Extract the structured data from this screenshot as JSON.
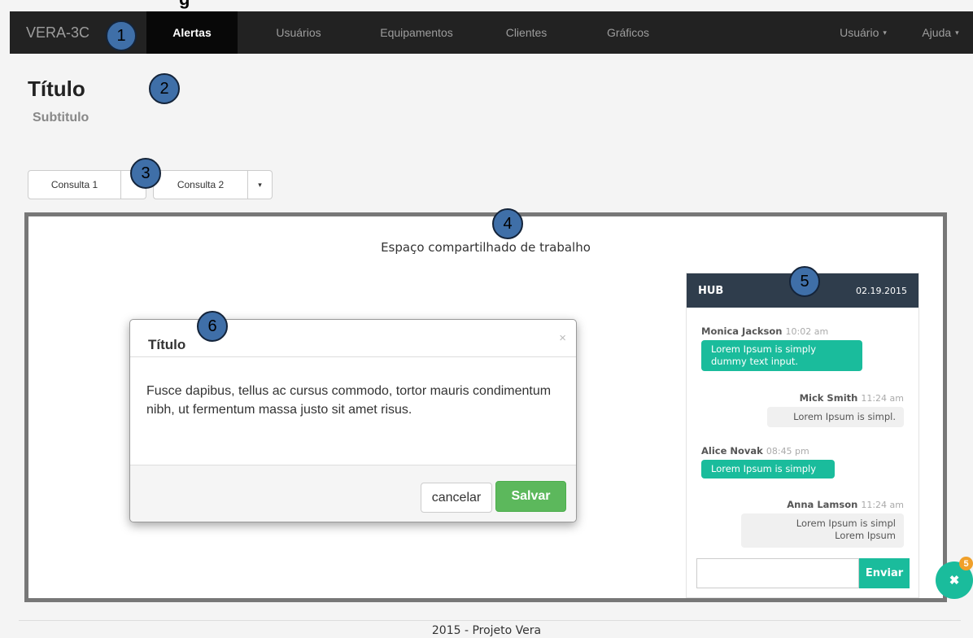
{
  "cutoff_heading": "g",
  "navbar": {
    "brand": "VERA-3C",
    "items": [
      {
        "label": "Alertas",
        "active": true
      },
      {
        "label": "Usuários"
      },
      {
        "label": "Equipamentos"
      },
      {
        "label": "Clientes"
      },
      {
        "label": "Gráficos"
      }
    ],
    "right_items": [
      {
        "label": "Usuário",
        "caret": "▾"
      },
      {
        "label": "Ajuda",
        "caret": "▾"
      }
    ]
  },
  "page": {
    "title": "Título",
    "subtitle": "Subtitulo"
  },
  "queries": [
    {
      "label": "Consulta 1"
    },
    {
      "label": "Consulta 2",
      "caret": "▾"
    }
  ],
  "workspace": {
    "title": "Espaço compartilhado de trabalho"
  },
  "modal": {
    "title": "Título",
    "close": "×",
    "body": "Fusce dapibus, tellus ac cursus commodo, tortor mauris condimentum nibh, ut fermentum massa justo sit amet risus.",
    "cancel_label": "cancelar",
    "save_label": "Salvar"
  },
  "hub": {
    "title": "HUB",
    "date": "02.19.2015",
    "messages": [
      {
        "author": "Monica Jackson",
        "time": "10:02 am",
        "text": "Lorem Ipsum is simply dummy text input."
      },
      {
        "author": "Mick Smith",
        "time": "11:24 am",
        "text": "Lorem Ipsum is simpl."
      },
      {
        "author": "Alice Novak",
        "time": "08:45 pm",
        "text": "Lorem Ipsum is simply"
      },
      {
        "author": "Anna Lamson",
        "time": "11:24 am",
        "text_line1": "Lorem Ipsum is simpl",
        "text_line2": "Lorem Ipsum"
      }
    ],
    "send_label": "Enviar"
  },
  "fab": {
    "icon": "close-icon",
    "glyph": "✖",
    "badge": "5"
  },
  "callouts": [
    "1",
    "2",
    "3",
    "4",
    "5",
    "6"
  ],
  "footer": {
    "text": "2015 - Projeto Vera"
  },
  "colors": {
    "navbar": "#222222",
    "accent": "#1abc9c",
    "save_button": "#5cb85c",
    "hub_header": "#2f3d4c",
    "callout": "#3f6fa8",
    "badge": "#f0a02a"
  }
}
